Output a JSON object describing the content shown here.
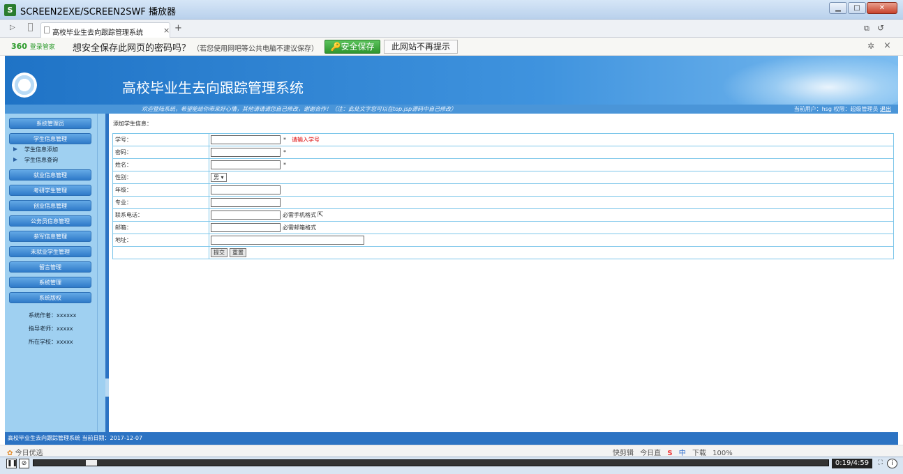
{
  "window": {
    "title": "SCREEN2EXE/SCREEN2SWF 播放器",
    "min": "▁",
    "max": "□",
    "close": "✕"
  },
  "browser": {
    "tab_label": "高校毕业生去向跟踪管理系统",
    "tab_close": "×",
    "new_tab": "+"
  },
  "password_bar": {
    "brand": "360",
    "brand_sub": "登录管家",
    "question": "想安全保存此网页的密码吗？",
    "tip": "（若您使用网吧等公共电脑不建议保存）",
    "save_label": "安全保存",
    "nomore_label": "此网站不再提示"
  },
  "header": {
    "system_name": "高校毕业生去向跟踪管理系统",
    "marquee": "欢迎登陆系统，希望能给你带来好心情，其他请请请您自己修改，谢谢合作！（注：此处文字您可以在top.jsp源码中自己修改）",
    "user_text": "当前用户：hsg 权限：超级管理员",
    "logout": "退出"
  },
  "sidebar": {
    "menus": [
      "系统管理员",
      "学生信息管理",
      "就业信息管理",
      "考研学生管理",
      "创业信息管理",
      "公务员信息管理",
      "参军信息管理",
      "未就业学生管理",
      "留言管理",
      "系统管理",
      "系统版权"
    ],
    "sub_items": [
      "学生信息添加",
      "学生信息查询"
    ],
    "meta": [
      "系统作者：xxxxxx",
      "指导老师：xxxxx",
      "所在学校：xxxxx"
    ]
  },
  "main": {
    "heading": "添加学生信息：",
    "fields": [
      {
        "label": "学号：",
        "required": "*",
        "error": "请输入学号"
      },
      {
        "label": "密码：",
        "required": "*"
      },
      {
        "label": "姓名：",
        "required": "*"
      },
      {
        "label": "性别：",
        "select": "男 ▾"
      },
      {
        "label": "年级："
      },
      {
        "label": "专业："
      },
      {
        "label": "联系电话：",
        "hint": "必需手机格式"
      },
      {
        "label": "邮箱：",
        "hint": "必需邮箱格式"
      },
      {
        "label": "地址："
      }
    ],
    "submit_label": "提交",
    "reset_label": "重置"
  },
  "footer": {
    "text": "高校毕业生去向跟踪管理系统 当前日期：2017-12-07"
  },
  "statusbar": {
    "left": "今日优选",
    "right_items": [
      "快剪辑",
      "今日直",
      "中",
      "下载",
      "100%"
    ]
  },
  "player": {
    "time": "0:19/4:59",
    "pause": "❚❚"
  },
  "colors": {
    "banner": "#2f82d2",
    "sidebar": "#9fd0f1",
    "table_border": "#7cc6ea",
    "save_green": "#3ea63e"
  }
}
